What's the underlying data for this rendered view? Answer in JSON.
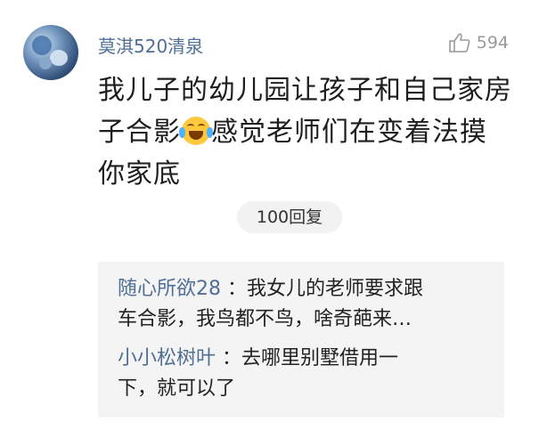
{
  "comment": {
    "username": "莫淇520清泉",
    "like_count": "594",
    "content_line1": "我儿子的幼儿园让孩子和自己家房",
    "content_line2a": "子合影",
    "content_line2b": "感觉老师们在变着法摸",
    "content_line3": "你家底",
    "emoji_icon": "laughing-crying-emoji-icon",
    "reply_count_label": "100回复"
  },
  "replies": [
    {
      "author": "随心所欲28",
      "text_line1": "：我女儿的老师要求跟",
      "text_line2": "车合影，我鸟都不鸟，啥奇葩来…"
    },
    {
      "author": "小小松树叶",
      "text_line1": "：去哪里别墅借用一",
      "text_line2": "下，就可以了"
    }
  ],
  "colors": {
    "author_link": "#4f6f96",
    "like_gray": "#9a9a9a",
    "reply_bg": "#f4f4f4"
  }
}
